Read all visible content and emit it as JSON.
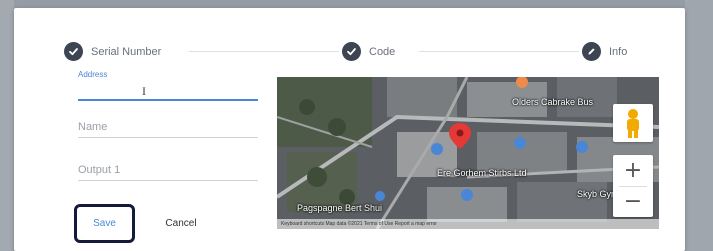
{
  "stepper": {
    "steps": [
      {
        "label": "Serial Number",
        "icon": "check-icon"
      },
      {
        "label": "Code",
        "icon": "check-icon"
      },
      {
        "label": "Info",
        "icon": "pencil-icon"
      }
    ]
  },
  "form": {
    "address_label": "Address",
    "address_value": "",
    "name_placeholder": "Name",
    "output_placeholder": "Output 1",
    "save_label": "Save",
    "cancel_label": "Cancel"
  },
  "map": {
    "labels": {
      "business_top": "Olders Cabrake Bus",
      "business_center": "Ere Gorhem Stirbs Ltd",
      "street_bottom": "Pagspagne Bert Shui",
      "right_side": "Skyb Gym"
    },
    "zoom_in": "+",
    "zoom_out": "−",
    "footer": "Keyboard shortcuts   Map data ©2021   Terms of Use   Report a map error"
  },
  "colors": {
    "accent": "#4a86d6",
    "step_icon": "#3d4452",
    "highlight_border": "#131a3a",
    "marker": "#e53935"
  }
}
